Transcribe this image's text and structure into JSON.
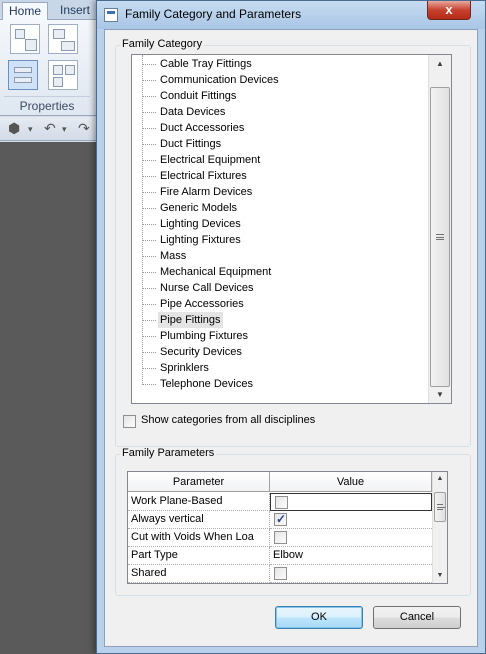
{
  "app": {
    "tabs": [
      "Home",
      "Insert"
    ],
    "panel_label": "Properties"
  },
  "dialog": {
    "title": "Family Category and Parameters",
    "close_symbol": "x",
    "category_group_label": "Family Category",
    "categories": [
      "Cable Tray Fittings",
      "Communication Devices",
      "Conduit Fittings",
      "Data Devices",
      "Duct Accessories",
      "Duct Fittings",
      "Electrical Equipment",
      "Electrical Fixtures",
      "Fire Alarm Devices",
      "Generic Models",
      "Lighting Devices",
      "Lighting Fixtures",
      "Mass",
      "Mechanical Equipment",
      "Nurse Call Devices",
      "Pipe Accessories",
      "Pipe Fittings",
      "Plumbing Fixtures",
      "Security Devices",
      "Sprinklers",
      "Telephone Devices"
    ],
    "selected_category": "Pipe Fittings",
    "show_all_label": "Show categories from all disciplines",
    "show_all_checked": false,
    "params_group_label": "Family Parameters",
    "params_header": {
      "param": "Parameter",
      "value": "Value"
    },
    "params": [
      {
        "name": "Work Plane-Based",
        "type": "checkbox",
        "checked": false
      },
      {
        "name": "Always vertical",
        "type": "checkbox",
        "checked": true
      },
      {
        "name": "Cut with Voids When Loa",
        "type": "checkbox",
        "checked": false
      },
      {
        "name": "Part Type",
        "type": "text",
        "value": "Elbow"
      },
      {
        "name": "Shared",
        "type": "checkbox",
        "checked": false
      }
    ],
    "ok_label": "OK",
    "cancel_label": "Cancel"
  }
}
